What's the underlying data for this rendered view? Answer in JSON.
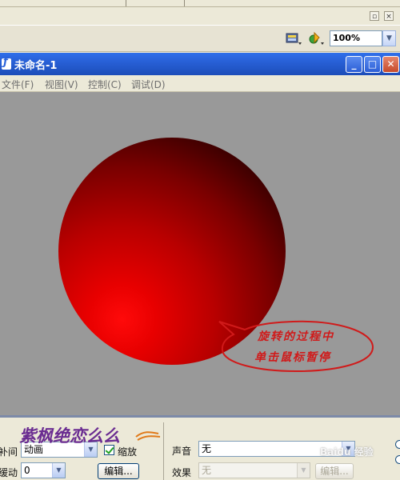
{
  "window": {
    "title": "未命名-1"
  },
  "toolbar": {
    "zoom": "100%"
  },
  "menu": [
    {
      "label": "文件(F)"
    },
    {
      "label": "视图(V)"
    },
    {
      "label": "控制(C)"
    },
    {
      "label": "调试(D)"
    }
  ],
  "stage": {
    "callout": {
      "line1": "旋转的过程中",
      "line2": "单击鼠标暂停"
    }
  },
  "properties": {
    "tween_label": "补间",
    "tween_value": "动画",
    "scale_label": "缩放",
    "scale_checked": true,
    "ease_label": "缓动",
    "ease_value": "0",
    "edit_button": "编辑...",
    "sound_label": "声音",
    "sound_value": "无",
    "effect_label": "效果",
    "effect_value": "无",
    "effect_edit_button": "编辑..."
  },
  "watermark": {
    "text": "紫枫绝恋么么",
    "baidu": "Baidu 经验"
  },
  "colors": {
    "titlebar": "#2A63DB",
    "stage_bg": "#999999",
    "callout": "#D01A1A",
    "ball": "#FF0000"
  },
  "icons": [
    "scene-icon",
    "symbol-icon",
    "zoom-dropdown-arrow-icon",
    "flash-doc-icon",
    "minimize-icon",
    "maximize-icon",
    "close-icon"
  ]
}
